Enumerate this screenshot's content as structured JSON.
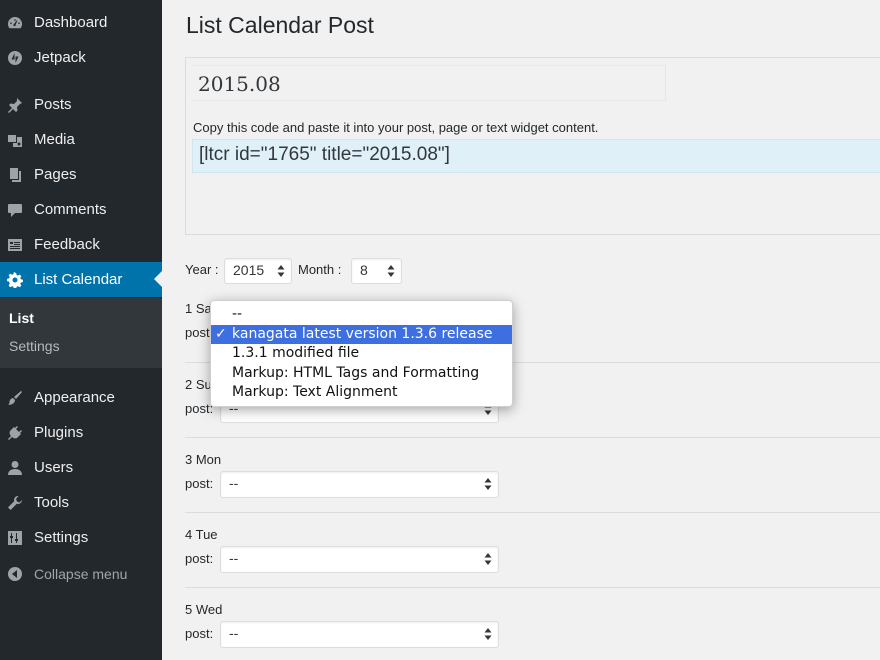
{
  "sidebar": {
    "items": [
      {
        "label": "Dashboard",
        "icon": "dashboard-icon"
      },
      {
        "label": "Jetpack",
        "icon": "jetpack-icon"
      },
      {
        "label": "Posts",
        "icon": "pin-icon"
      },
      {
        "label": "Media",
        "icon": "media-icon"
      },
      {
        "label": "Pages",
        "icon": "pages-icon"
      },
      {
        "label": "Comments",
        "icon": "comment-icon"
      },
      {
        "label": "Feedback",
        "icon": "feedback-icon"
      },
      {
        "label": "List Calendar",
        "icon": "gear-icon",
        "active": true
      },
      {
        "label": "Appearance",
        "icon": "brush-icon"
      },
      {
        "label": "Plugins",
        "icon": "plug-icon"
      },
      {
        "label": "Users",
        "icon": "user-icon"
      },
      {
        "label": "Tools",
        "icon": "wrench-icon"
      },
      {
        "label": "Settings",
        "icon": "settings-sliders-icon"
      }
    ],
    "submenu": [
      {
        "label": "List",
        "current": true
      },
      {
        "label": "Settings"
      }
    ],
    "collapse_label": "Collapse menu",
    "accent_color": "#0073aa"
  },
  "main": {
    "title": "List Calendar Post",
    "post_title": "2015.08",
    "copy_hint": "Copy this code and paste it into your post, page or text widget content.",
    "shortcode": "[ltcr id=\"1765\" title=\"2015.08\"]",
    "year_label": "Year :",
    "year_value": "2015",
    "month_label": "Month :",
    "month_value": "8",
    "post_label": "post:",
    "days": [
      {
        "label": "1 Sat",
        "value": "--"
      },
      {
        "label": "2 Sun",
        "value": "--"
      },
      {
        "label": "3 Mon",
        "value": "--"
      },
      {
        "label": "4 Tue",
        "value": "--"
      },
      {
        "label": "5 Wed",
        "value": "--"
      }
    ]
  },
  "dropdown": {
    "options": [
      {
        "label": "--"
      },
      {
        "label": "kanagata latest version 1.3.6 release",
        "selected": true
      },
      {
        "label": "1.3.1 modified file"
      },
      {
        "label": "Markup: HTML Tags and Formatting"
      },
      {
        "label": "Markup: Text Alignment"
      }
    ],
    "check_mark": "✓",
    "highlight_color": "#3d6fe0"
  }
}
